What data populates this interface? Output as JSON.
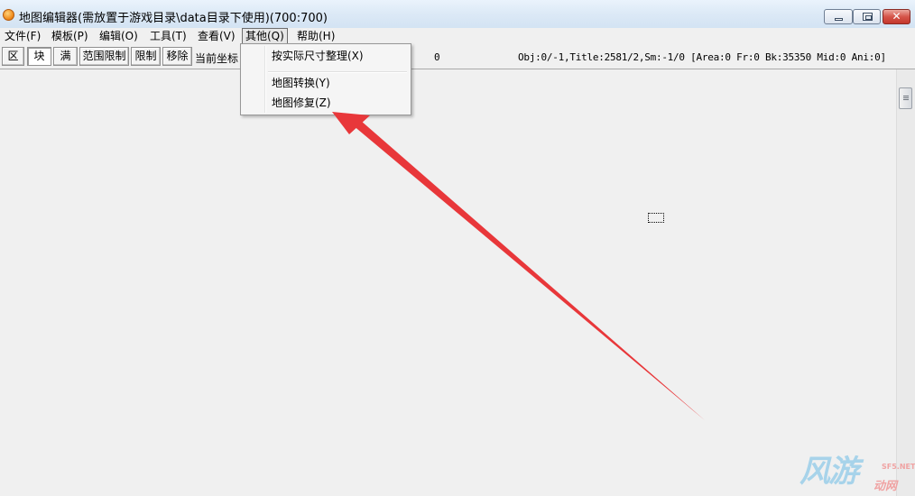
{
  "window": {
    "title": "地图编辑器(需放置于游戏目录\\data目录下使用)(700:700)",
    "close_glyph": "✕"
  },
  "menubar": {
    "items": [
      "文件(F)",
      "模板(P)",
      "编辑(O)",
      "工具(T)",
      "查看(V)",
      "其他(Q)",
      "帮助(H)"
    ],
    "active": "其他(Q)"
  },
  "toolbar": {
    "buttons": [
      "区",
      "块",
      "满",
      "范围限制",
      "限制",
      "移除"
    ],
    "pressed": "块",
    "coord_label": "当前坐标",
    "zero_value": "0",
    "status": "Obj:0/-1,Title:2581/2,Sm:-1/0 [Area:0 Fr:0 Bk:35350 Mid:0 Ani:0]"
  },
  "dropdown": {
    "items": [
      "按实际尺寸整理(X)",
      "地图转换(Y)",
      "地图修复(Z)"
    ]
  },
  "watermark": {
    "main": "风游",
    "sub": "动网",
    "url": "SF5.NET"
  },
  "colors": {
    "arrow": "#e8373a",
    "titlebar": "#dce9f6",
    "background": "#f0f0f0"
  }
}
